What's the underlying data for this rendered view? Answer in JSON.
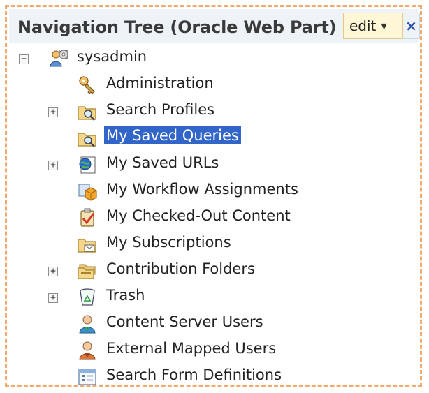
{
  "webpart": {
    "title": "Navigation Tree (Oracle Web Part)",
    "edit_label": "edit",
    "edit_caret": "▼",
    "close_label": "×"
  },
  "tree": {
    "root": {
      "label": "sysadmin",
      "toggle": "−",
      "icon": "user-settings-icon"
    },
    "items": [
      {
        "label": "Administration",
        "icon": "key-icon",
        "toggle": ""
      },
      {
        "label": "Search Profiles",
        "icon": "folder-search-icon",
        "toggle": "+"
      },
      {
        "label": "My Saved Queries",
        "icon": "folder-search-icon",
        "toggle": "",
        "selected": true
      },
      {
        "label": "My Saved URLs",
        "icon": "saved-urls-icon",
        "toggle": "+"
      },
      {
        "label": "My Workflow Assignments",
        "icon": "workflow-icon",
        "toggle": ""
      },
      {
        "label": "My Checked-Out Content",
        "icon": "checked-out-icon",
        "toggle": ""
      },
      {
        "label": "My Subscriptions",
        "icon": "subscription-folder-icon",
        "toggle": ""
      },
      {
        "label": "Contribution Folders",
        "icon": "contribution-folders-icon",
        "toggle": "+"
      },
      {
        "label": "Trash",
        "icon": "trash-icon",
        "toggle": "+"
      },
      {
        "label": "Content Server Users",
        "icon": "user-icon",
        "toggle": ""
      },
      {
        "label": "External Mapped Users",
        "icon": "external-user-icon",
        "toggle": ""
      },
      {
        "label": "Search Form Definitions",
        "icon": "form-definition-icon",
        "toggle": ""
      }
    ]
  },
  "colors": {
    "selection": "#3165c8",
    "frame_border": "#f3a96b",
    "title_bg": "#eef3f8"
  }
}
